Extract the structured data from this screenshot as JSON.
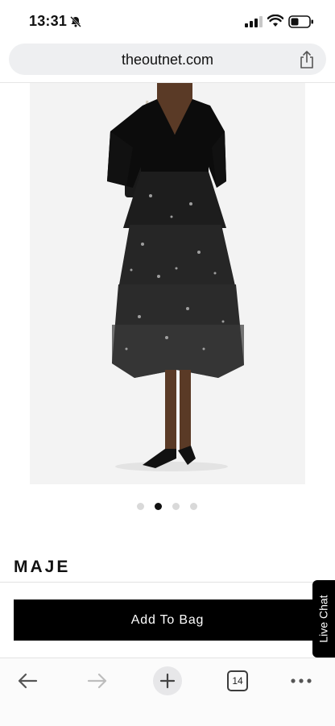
{
  "status_bar": {
    "time": "13:31"
  },
  "browser": {
    "url": "theoutnet.com",
    "open_tab_count": "14"
  },
  "gallery": {
    "image_count": 4,
    "active_index": 1
  },
  "product": {
    "brand": "MAJE",
    "add_to_bag_label": "Add To Bag"
  },
  "live_chat": {
    "label": "Live Chat"
  },
  "icons": {
    "status": [
      "bell-slash-icon",
      "signal-icon",
      "wifi-icon",
      "battery-icon"
    ],
    "address_bar": [
      "share-icon"
    ],
    "toolbar": [
      "back-arrow-icon",
      "forward-arrow-icon",
      "plus-icon",
      "tabs-icon",
      "more-icon"
    ]
  },
  "colors": {
    "button_bg": "#000000",
    "button_text": "#ffffff",
    "address_bar_bg": "#eeeff1"
  }
}
